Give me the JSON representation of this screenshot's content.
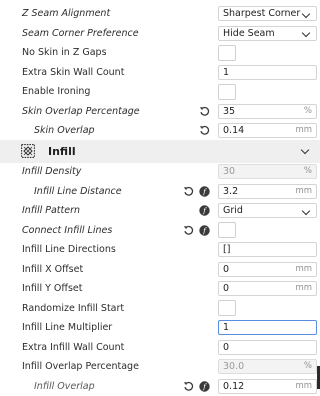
{
  "settings": {
    "z_seam_alignment": {
      "label": "Z Seam Alignment",
      "value": "Sharpest Corner"
    },
    "seam_corner_preference": {
      "label": "Seam Corner Preference",
      "value": "Hide Seam"
    },
    "no_skin_z_gaps": {
      "label": "No Skin in Z Gaps"
    },
    "extra_skin_wall_count": {
      "label": "Extra Skin Wall Count",
      "value": "1"
    },
    "enable_ironing": {
      "label": "Enable Ironing"
    },
    "skin_overlap_percentage": {
      "label": "Skin Overlap Percentage",
      "value": "35",
      "unit": "%"
    },
    "skin_overlap": {
      "label": "Skin Overlap",
      "value": "0.14",
      "unit": "mm"
    }
  },
  "section": {
    "title": "Infill"
  },
  "infill": {
    "density": {
      "label": "Infill Density",
      "value": "30",
      "unit": "%"
    },
    "line_distance": {
      "label": "Infill Line Distance",
      "value": "3.2",
      "unit": "mm"
    },
    "pattern": {
      "label": "Infill Pattern",
      "value": "Grid"
    },
    "connect_lines": {
      "label": "Connect Infill Lines"
    },
    "line_directions": {
      "label": "Infill Line Directions",
      "value": "[]"
    },
    "x_offset": {
      "label": "Infill X Offset",
      "value": "0",
      "unit": "mm"
    },
    "y_offset": {
      "label": "Infill Y Offset",
      "value": "0",
      "unit": "mm"
    },
    "randomize_start": {
      "label": "Randomize Infill Start"
    },
    "line_multiplier": {
      "label": "Infill Line Multiplier",
      "value": "1"
    },
    "extra_wall_count": {
      "label": "Extra Infill Wall Count",
      "value": "0"
    },
    "overlap_percentage": {
      "label": "Infill Overlap Percentage",
      "value": "30.0",
      "unit": "%"
    },
    "overlap": {
      "label": "Infill Overlap",
      "value": "0.12",
      "unit": "mm"
    }
  },
  "icons": {
    "reset": "reset-icon",
    "function": "function-icon",
    "section": "infill-grid-icon"
  },
  "colors": {
    "section_bg": "#efefef",
    "active_border": "#5a8de0",
    "readonly_bg": "#f3f3f3"
  }
}
